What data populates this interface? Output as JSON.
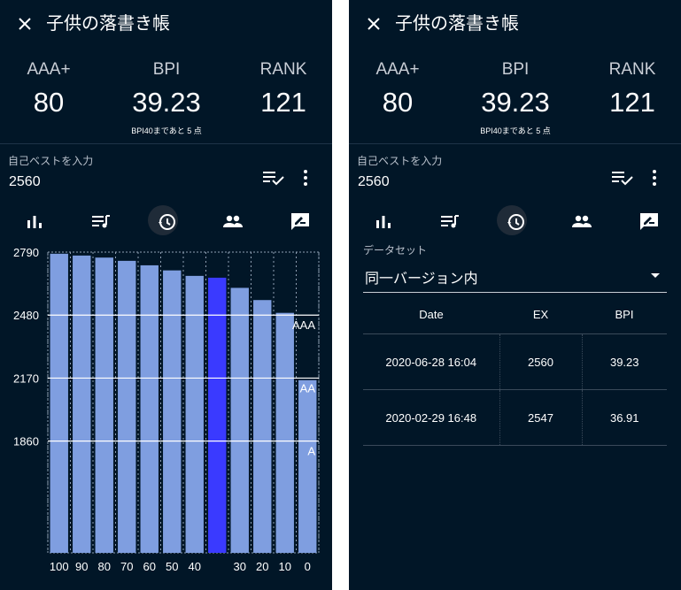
{
  "song_title": "子供の落書き帳",
  "stats": {
    "aaa_label": "AAA+",
    "aaa_value": "80",
    "bpi_label": "BPI",
    "bpi_value": "39.23",
    "bpi_note": "BPI40まであと 5 点",
    "rank_label": "RANK",
    "rank_value": "121"
  },
  "best": {
    "label": "自己ベストを入力",
    "value": "2560"
  },
  "icons": {
    "close": "close-icon",
    "playlist_check": "playlist-check-icon",
    "more": "more-vert-icon",
    "tabs": [
      "bar-chart-icon",
      "music-list-icon",
      "history-icon",
      "people-icon",
      "rate-review-icon"
    ]
  },
  "colors": {
    "background": "#011627",
    "bar": "#7f9ee0",
    "bar_highlight": "#3a3aff"
  },
  "dataset": {
    "label": "データセット",
    "value": "同一バージョン内"
  },
  "history_table": {
    "headers": [
      "Date",
      "EX",
      "BPI"
    ],
    "rows": [
      [
        "2020-06-28 16:04",
        "2560",
        "39.23"
      ],
      [
        "2020-02-29 16:48",
        "2547",
        "36.91"
      ]
    ]
  },
  "chart_data": {
    "type": "bar",
    "categories": [
      "100",
      "90",
      "80",
      "70",
      "60",
      "50",
      "40",
      "",
      "30",
      "20",
      "10",
      "0"
    ],
    "values": [
      2782,
      2773,
      2763,
      2747,
      2725,
      2700,
      2673,
      2664,
      2614,
      2554,
      2491,
      2160
    ],
    "highlight_index": 7,
    "yticks": [
      2790,
      2480,
      2170,
      1860
    ],
    "ylim": [
      1310,
      2790
    ],
    "reference_lines": [
      {
        "label": "AAA",
        "value": 2480
      },
      {
        "label": "AA",
        "value": 2170
      },
      {
        "label": "A",
        "value": 1860
      }
    ],
    "xlabel": "",
    "ylabel": ""
  }
}
